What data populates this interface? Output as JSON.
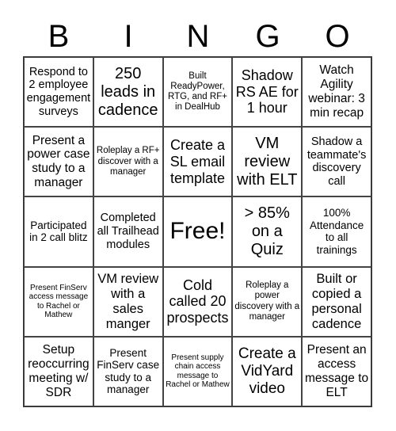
{
  "header": {
    "letters": [
      "B",
      "I",
      "N",
      "G",
      "O"
    ]
  },
  "cells": [
    "Respond to 2 employee engagement surveys",
    "250 leads in cadence",
    "Built ReadyPower, RTG, and RF+ in DealHub",
    "Shadow RS AE for 1 hour",
    "Watch Agility webinar: 3 min recap",
    "Present a power case study to a manager",
    "Roleplay a RF+ discover with a manager",
    "Create a SL email template",
    "VM review with ELT",
    "Shadow a teammate's discovery call",
    "Participated in 2 call blitz",
    "Completed all Trailhead modules",
    "Free!",
    "> 85% on a Quiz",
    "100% Attendance to all trainings",
    "Present FinServ access message to Rachel or Mathew",
    "VM review with a sales manger",
    "Cold called 20 prospects",
    "Roleplay a power discovery with a manager",
    "Built or copied a personal cadence",
    "Setup reoccurring meeting w/ SDR",
    "Present FinServ case study to a manager",
    "Present supply chain access message to Rachel or Mathew",
    "Create a VidYard video",
    "Present an access message to ELT"
  ]
}
